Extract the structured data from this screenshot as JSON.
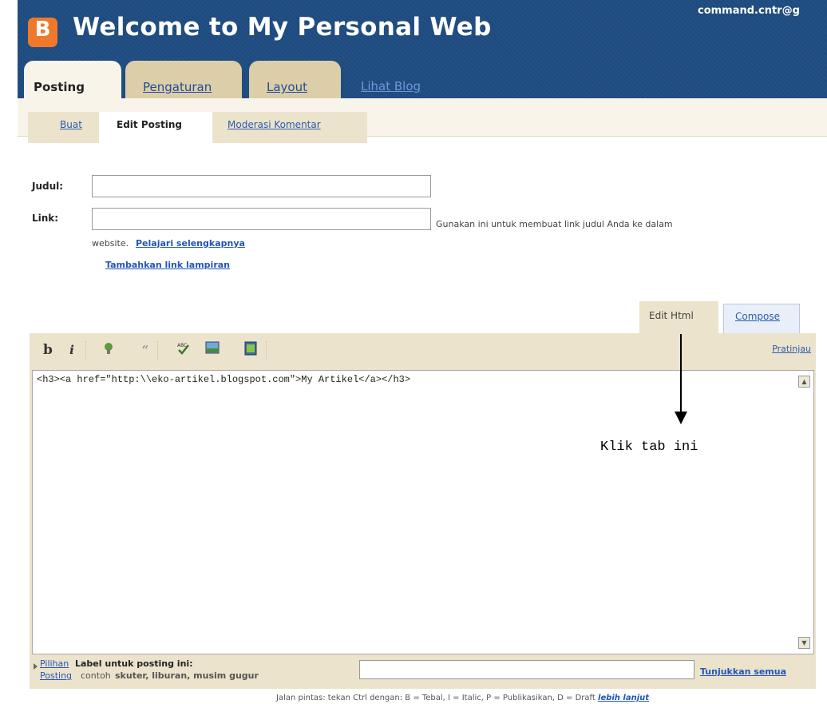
{
  "header": {
    "logo_letter": "B",
    "blog_title": "Welcome to My Personal Web",
    "user_email": "command.cntr@g"
  },
  "main_tabs": {
    "posting": "Posting",
    "pengaturan": "Pengaturan",
    "layout": "Layout",
    "lihat_blog": "Lihat Blog"
  },
  "sub_tabs": {
    "buat": "Buat",
    "edit_posting": "Edit Posting",
    "moderasi": "Moderasi Komentar"
  },
  "form": {
    "title_label": "Judul:",
    "title_value": "",
    "link_label": "Link:",
    "link_value": "",
    "link_hint_1": "Gunakan ini untuk membuat link judul Anda ke dalam",
    "link_hint_2": "website.",
    "learn_more": "Pelajari selengkapnya",
    "add_attachment": "Tambahkan link lampiran"
  },
  "editor": {
    "tab_edit_html": "Edit Html",
    "tab_compose": "Compose",
    "bold": "b",
    "italic": "i",
    "preview": "Pratinjau",
    "content": "<h3><a href=\"http:\\\\eko-artikel.blogspot.com\">My Artikel</a></h3>"
  },
  "annotation": {
    "text": "Klik tab ini"
  },
  "labels": {
    "line1_link": "Pilihan",
    "line1_text": "Label untuk posting ini:",
    "line2_link": "Posting",
    "line2_prefix": "contoh",
    "line2_examples": "skuter, liburan, musim gugur",
    "input_value": "",
    "show_all": "Tunjukkan semua"
  },
  "footer": {
    "shortcut_hint": "Jalan pintas: tekan Ctrl dengan: B = Tebal, I = Italic, P = Publikasikan, D = Draft",
    "more_link": "lebih lanjut"
  },
  "colors": {
    "header_bg": "#1d4a7f",
    "logo_orange": "#f0782a",
    "tab_beige": "#dccea9",
    "panel_beige": "#ece3cc",
    "link_blue": "#2255bb"
  },
  "icons": [
    "bold-icon",
    "italic-icon",
    "link-icon",
    "quote-icon",
    "spellcheck-icon",
    "image-icon",
    "video-icon"
  ]
}
